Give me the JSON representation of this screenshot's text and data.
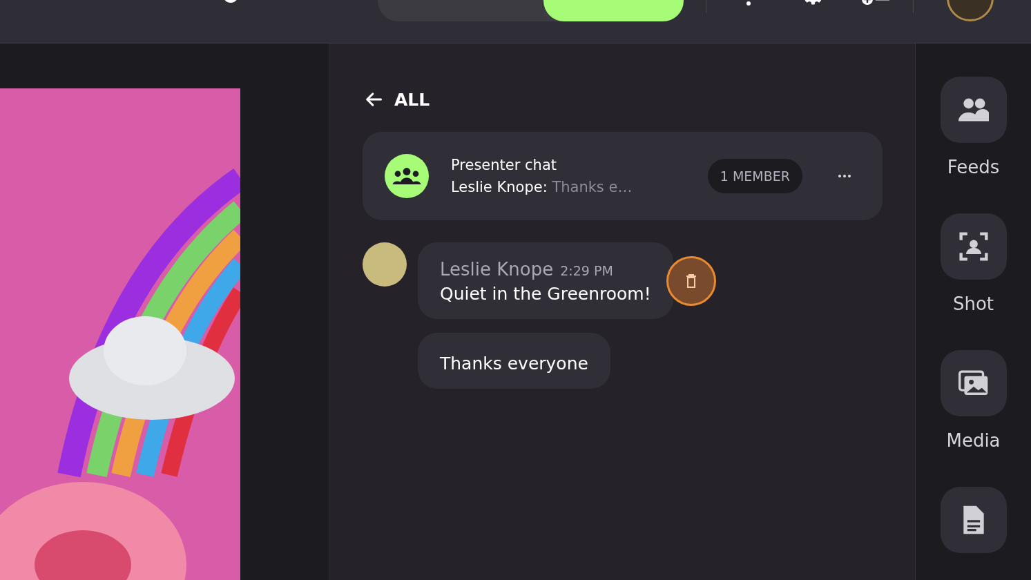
{
  "back_link": {
    "label": "ALL"
  },
  "chat": {
    "title": "Presenter chat",
    "sender": "Leslie Knope:",
    "preview": "Thanks e…",
    "members": "1 MEMBER"
  },
  "messages": [
    {
      "author": "Leslie Knope",
      "time": "2:29 PM",
      "text": "Quiet in the Greenroom!",
      "delete_visible": true
    },
    {
      "text": "Thanks everyone",
      "delete_visible": false
    }
  ],
  "rail": [
    {
      "kind": "feeds",
      "label": "Feeds"
    },
    {
      "kind": "shot",
      "label": "Shot"
    },
    {
      "kind": "media",
      "label": "Media"
    },
    {
      "kind": "document"
    }
  ]
}
